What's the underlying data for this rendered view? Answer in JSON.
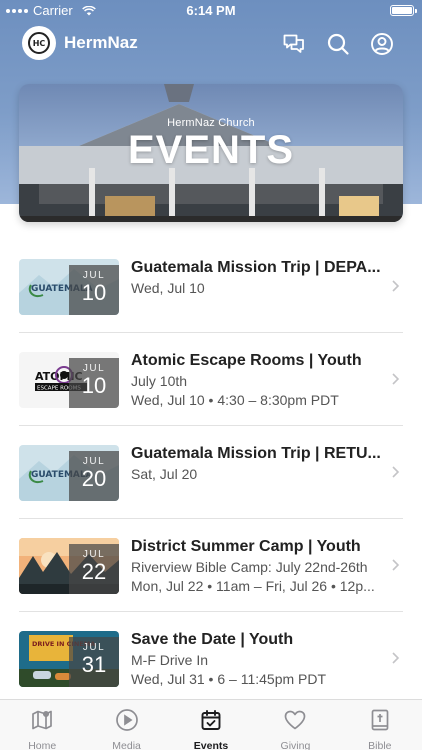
{
  "status_bar": {
    "carrier": "Carrier",
    "time": "6:14 PM"
  },
  "header": {
    "app_name": "HermNaz",
    "logo_text": "HC",
    "icons": [
      "chat-bubbles-icon",
      "search-icon",
      "account-icon"
    ]
  },
  "hero": {
    "subtitle": "HermNaz Church",
    "title": "EVENTS"
  },
  "events": [
    {
      "title": "Guatemala Mission Trip | DEPA...",
      "line1": "Wed, Jul 10",
      "line2": "",
      "month": "JUL",
      "day": "10",
      "thumb": "guatemala"
    },
    {
      "title": "Atomic Escape Rooms | Youth",
      "line1": "July 10th",
      "line2": "Wed, Jul 10 • 4:30 – 8:30pm PDT",
      "month": "JUL",
      "day": "10",
      "thumb": "atomic"
    },
    {
      "title": "Guatemala Mission Trip | RETU...",
      "line1": "Sat, Jul 20",
      "line2": "",
      "month": "JUL",
      "day": "20",
      "thumb": "guatemala"
    },
    {
      "title": "District Summer Camp | Youth",
      "line1": "Riverview Bible Camp: July 22nd-26th",
      "line2": "Mon, Jul 22 • 11am – Fri, Jul 26 • 12p...",
      "month": "JUL",
      "day": "22",
      "thumb": "camp"
    },
    {
      "title": "Save the Date | Youth",
      "line1": "M-F Drive In",
      "line2": "Wed, Jul 31 • 6 – 11:45pm PDT",
      "month": "JUL",
      "day": "31",
      "thumb": "drivein"
    }
  ],
  "thumb_text": {
    "guatemala": "GUATEMALA",
    "atomic_top": "ATOMIC",
    "atomic_bottom": "ESCAPE ROOMS",
    "drivein": "DRIVE IN CINEMA"
  },
  "tabs": [
    {
      "label": "Home",
      "icon": "map-icon",
      "active": false
    },
    {
      "label": "Media",
      "icon": "play-circle-icon",
      "active": false
    },
    {
      "label": "Events",
      "icon": "calendar-check-icon",
      "active": true
    },
    {
      "label": "Giving",
      "icon": "heart-icon",
      "active": false
    },
    {
      "label": "Bible",
      "icon": "bible-icon",
      "active": false
    }
  ],
  "colors": {
    "header_blue": "#7e9dc8",
    "active_tab": "#1c1c1e",
    "inactive_tab": "#8e8e93"
  }
}
